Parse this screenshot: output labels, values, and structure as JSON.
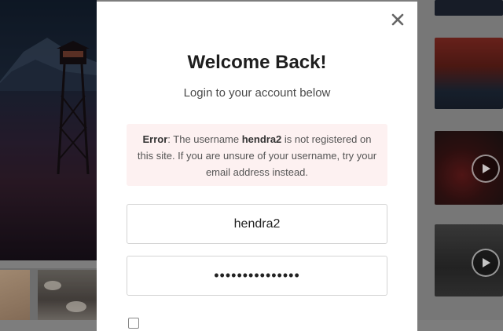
{
  "modal": {
    "title": "Welcome Back!",
    "subtitle": "Login to your account below",
    "close_icon": "close-icon",
    "error": {
      "label": "Error",
      "text_before": ": The username ",
      "username": "hendra2",
      "text_after": " is not registered on this site. If you are unsure of your username, try your email address instead."
    },
    "username_value": "hendra2",
    "password_value": "•••••••••••••••",
    "remember_checked": false
  },
  "background": {
    "icons": [
      "play-icon",
      "play-icon"
    ]
  },
  "colors": {
    "error_bg": "#fdf1f1",
    "overlay": "#7d7d7d",
    "title": "#1e1e1e"
  }
}
